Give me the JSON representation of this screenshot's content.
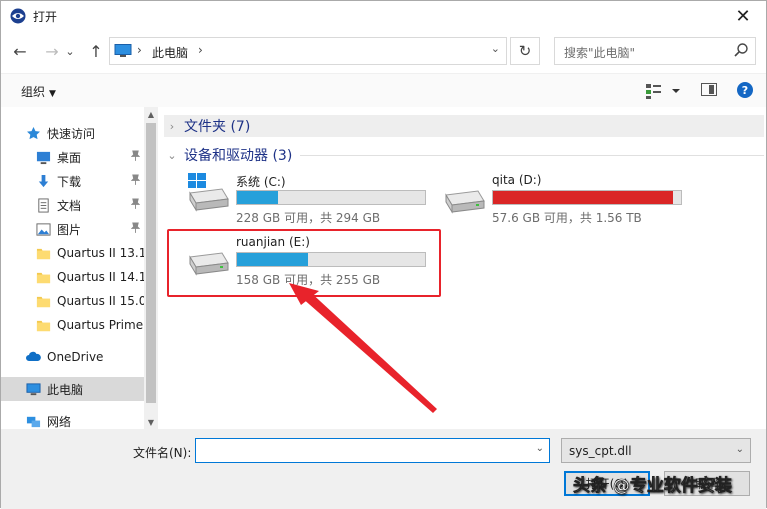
{
  "window": {
    "title": "打开",
    "close_glyph": "✕"
  },
  "nav": {
    "back_glyph": "←",
    "forward_glyph": "→",
    "recent_glyph": "⌄",
    "up_glyph": "↑",
    "crumb_sep": "›",
    "breadcrumb": "此电脑",
    "addr_dropdown": "⌄",
    "refresh_glyph": "↻"
  },
  "search": {
    "placeholder": "搜索\"此电脑\""
  },
  "toolbar": {
    "organize_label": "组织",
    "organize_caret": "▼",
    "help_label": "?"
  },
  "sidebar": {
    "items": [
      {
        "label": "快速访问",
        "icon": "star-icon"
      },
      {
        "label": "桌面",
        "icon": "desktop-icon",
        "pinned": true
      },
      {
        "label": "下载",
        "icon": "download-icon",
        "pinned": true
      },
      {
        "label": "文档",
        "icon": "document-icon",
        "pinned": true
      },
      {
        "label": "图片",
        "icon": "picture-icon",
        "pinned": true
      },
      {
        "label": "Quartus II 13.1",
        "icon": "folder-icon"
      },
      {
        "label": "Quartus II 14.1",
        "icon": "folder-icon"
      },
      {
        "label": "Quartus II 15.0",
        "icon": "folder-icon"
      },
      {
        "label": "Quartus Prime",
        "icon": "folder-icon"
      },
      {
        "label": "OneDrive",
        "icon": "cloud-icon"
      },
      {
        "label": "此电脑",
        "icon": "computer-icon",
        "selected": true
      },
      {
        "label": "网络",
        "icon": "network-icon"
      }
    ],
    "pin_glyph": "📌",
    "scroll_up": "▲",
    "scroll_down": "▼"
  },
  "groups": {
    "folders": {
      "label": "文件夹 (7)",
      "chev": "›"
    },
    "drives": {
      "label": "设备和驱动器 (3)",
      "chev": "⌄"
    }
  },
  "drives": [
    {
      "name": "系统 (C:)",
      "caption": "228 GB 可用，共 294 GB",
      "used_fraction": 0.22,
      "bar_color": "#26a0da",
      "icon": "windows-drive-icon"
    },
    {
      "name": "qita (D:)",
      "caption": "57.6 GB 可用，共 1.56 TB",
      "used_fraction": 0.96,
      "bar_color": "#da2626",
      "icon": "drive-icon"
    },
    {
      "name": "ruanjian (E:)",
      "caption": "158 GB 可用，共 255 GB",
      "used_fraction": 0.38,
      "bar_color": "#26a0da",
      "icon": "drive-icon"
    }
  ],
  "bottom": {
    "filename_label": "文件名(N):",
    "filename_value": "",
    "filetype_value": "sys_cpt.dll",
    "dropdown_glyph": "⌄",
    "open_label": "打开(O)",
    "cancel_label": "取消",
    "watermark": "头条 @专业软件安装"
  }
}
